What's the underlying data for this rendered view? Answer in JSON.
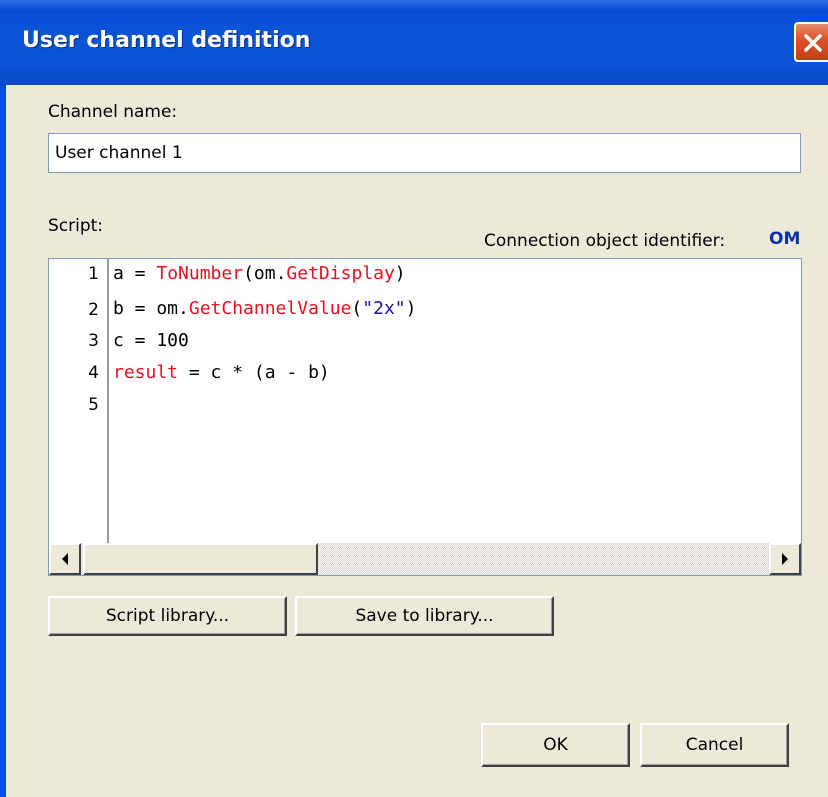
{
  "window": {
    "title": "User channel definition"
  },
  "channel_name": {
    "label": "Channel name:",
    "value": "User channel 1"
  },
  "script": {
    "label": "Script:",
    "connection_label": "Connection object identifier:",
    "connection_id": "OM",
    "line_numbers": [
      "1",
      "2",
      "3",
      "4",
      "5"
    ],
    "lines": [
      [
        {
          "t": "a = ",
          "c": "plain"
        },
        {
          "t": "ToNumber",
          "c": "red"
        },
        {
          "t": "(om.",
          "c": "plain"
        },
        {
          "t": "GetDisplay",
          "c": "red"
        },
        {
          "t": ")",
          "c": "plain"
        }
      ],
      [
        {
          "t": "b = om.",
          "c": "plain"
        },
        {
          "t": "GetChannelValue",
          "c": "red"
        },
        {
          "t": "(",
          "c": "plain"
        },
        {
          "t": "\"2x\"",
          "c": "blue"
        },
        {
          "t": ")",
          "c": "plain"
        }
      ],
      [
        {
          "t": "c = 100",
          "c": "plain"
        }
      ],
      [
        {
          "t": "result",
          "c": "red"
        },
        {
          "t": " = c * (a - b)",
          "c": "plain"
        }
      ],
      []
    ]
  },
  "buttons": {
    "script_library": "Script library...",
    "save_to_library": "Save to library...",
    "ok": "OK",
    "cancel": "Cancel"
  },
  "icons": {
    "close": "close-icon",
    "scroll_left": "arrow-left-icon",
    "scroll_right": "arrow-right-icon"
  },
  "colors": {
    "titlebar": "#0a4ed6",
    "close_button": "#d9522a",
    "dialog_background": "#ece9d8",
    "keyword_red": "#e8111f",
    "string_blue": "#1414a8",
    "connection_id": "#0a2fa8"
  }
}
